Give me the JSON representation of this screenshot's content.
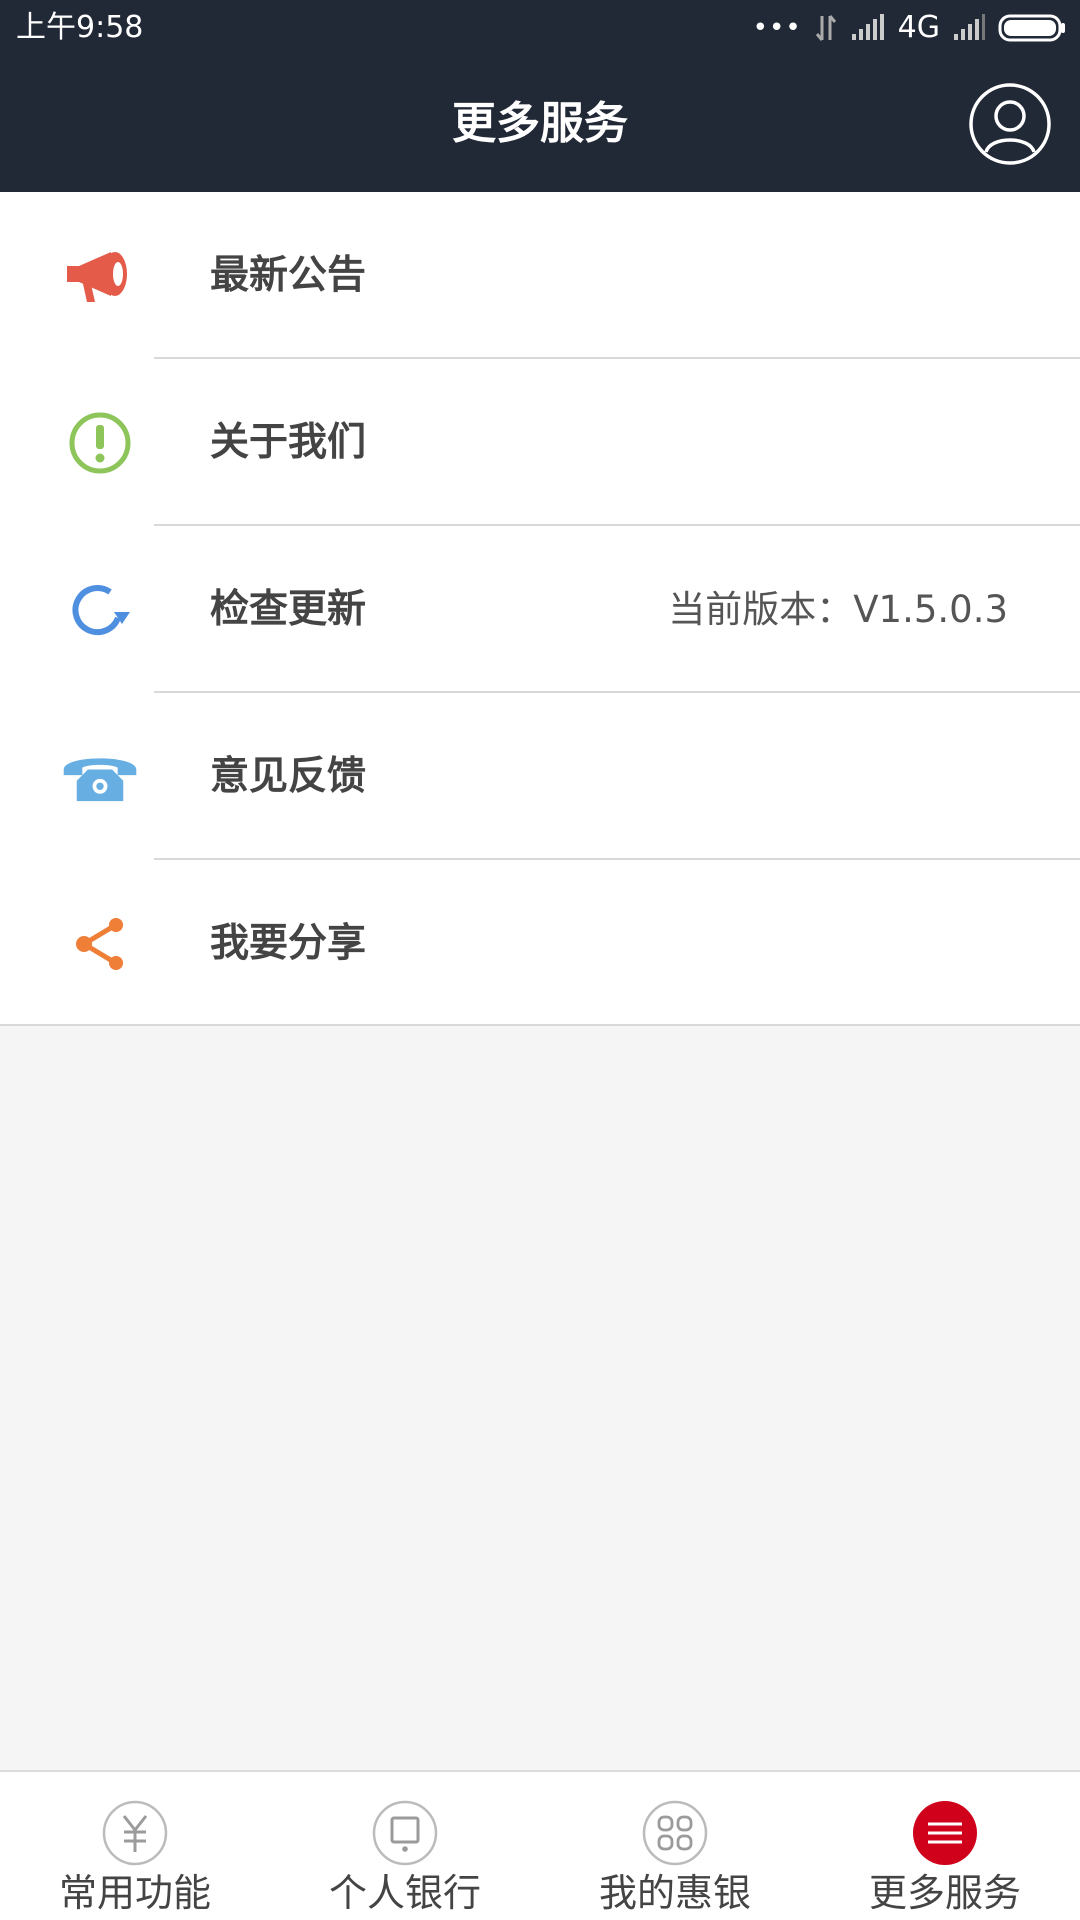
{
  "status_bar": {
    "time": "上午9:58",
    "dots": "•••",
    "network": "4G"
  },
  "header": {
    "title": "更多服务"
  },
  "menu": {
    "items": [
      {
        "label": "最新公告",
        "icon": "megaphone-icon",
        "color": "#e55b4a"
      },
      {
        "label": "关于我们",
        "icon": "info-icon",
        "color": "#8dc55a"
      },
      {
        "label": "检查更新",
        "icon": "refresh-icon",
        "color": "#4f8fe0",
        "value": "当前版本：V1.5.0.3"
      },
      {
        "label": "意见反馈",
        "icon": "phone-icon",
        "color": "#67aee3"
      },
      {
        "label": "我要分享",
        "icon": "share-icon",
        "color": "#ef7e36"
      }
    ]
  },
  "tabbar": {
    "tabs": [
      {
        "label": "常用功能",
        "icon": "yen-icon",
        "active": false
      },
      {
        "label": "个人银行",
        "icon": "monitor-icon",
        "active": false
      },
      {
        "label": "我的惠银",
        "icon": "grid-icon",
        "active": false
      },
      {
        "label": "更多服务",
        "icon": "menu-icon",
        "active": true
      }
    ],
    "active_color": "#d0021b",
    "inactive_color": "#9b9b9b"
  }
}
